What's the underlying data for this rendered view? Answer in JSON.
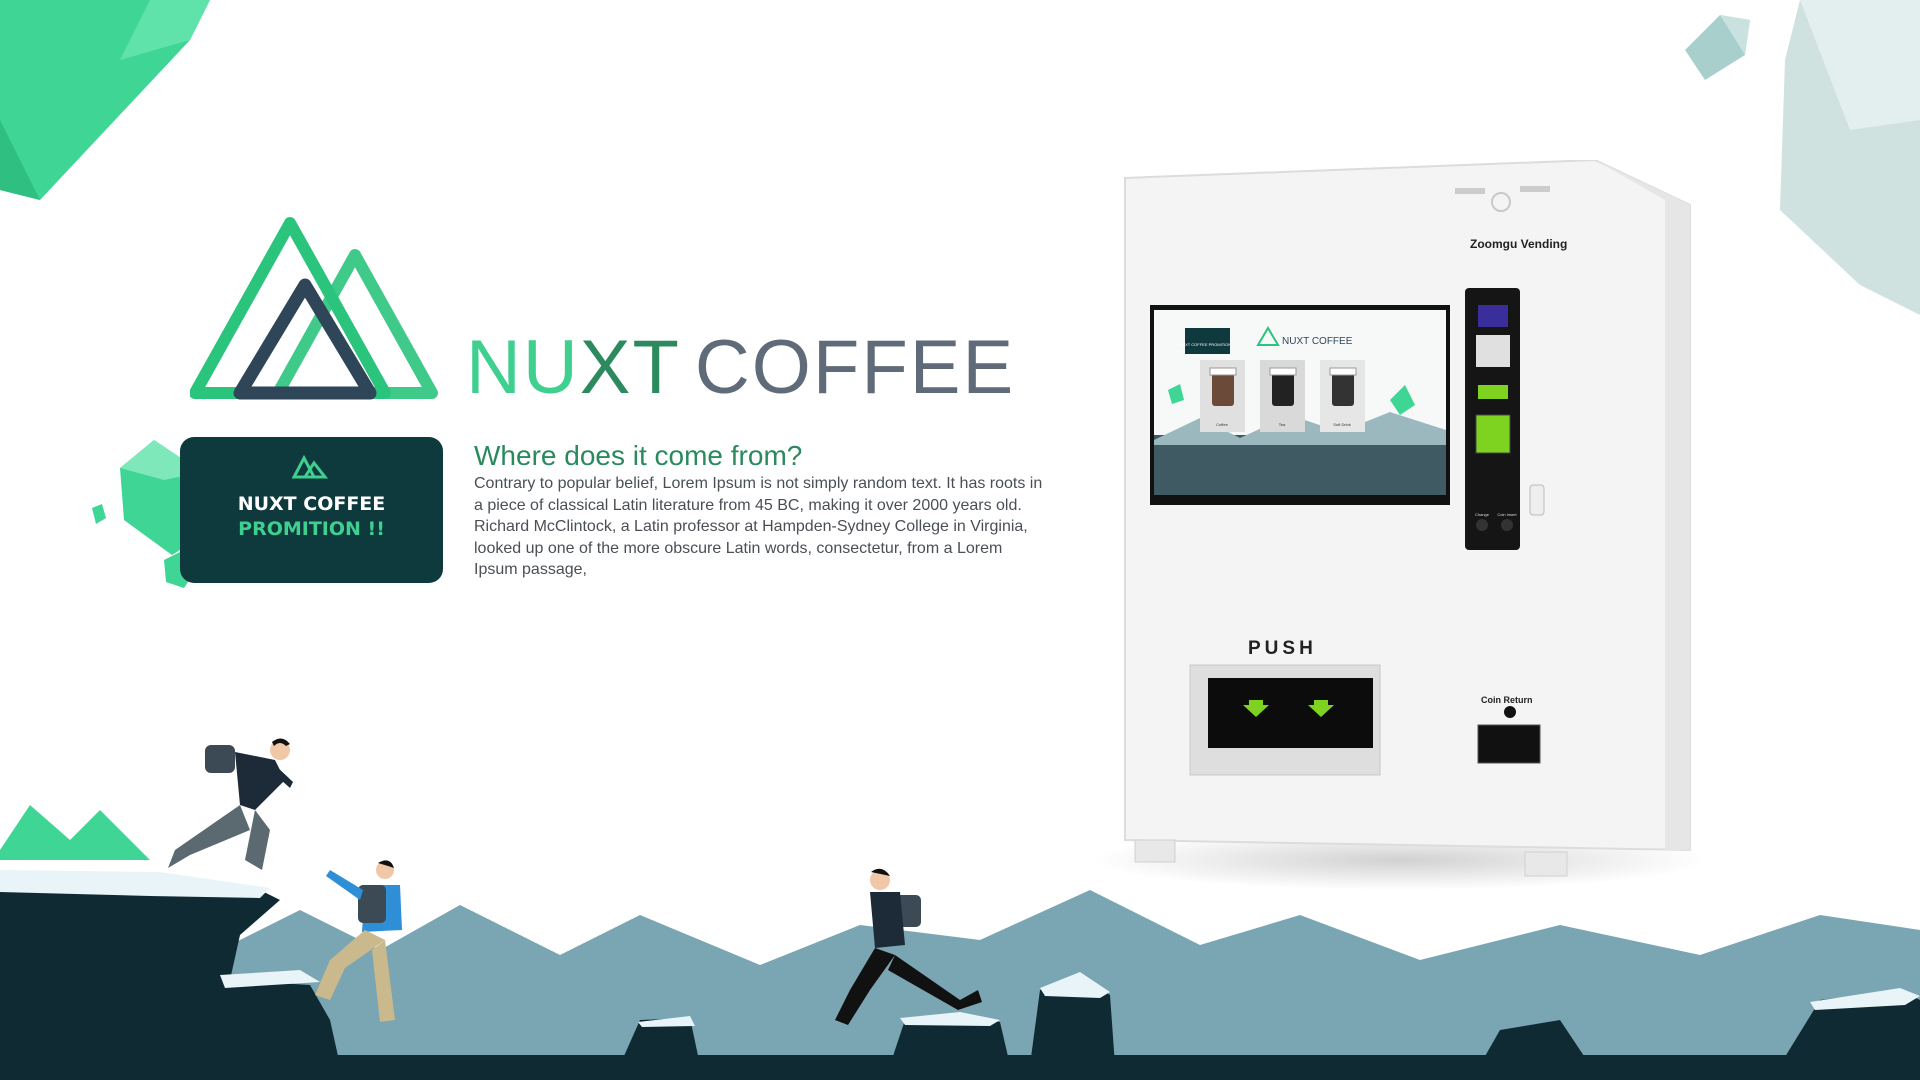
{
  "brand": {
    "title_part1": "NU",
    "title_part2": "XT",
    "title_part3": "COFFEE"
  },
  "promo": {
    "line1": "NUXT COFFEE",
    "line2": "PROMITION !!"
  },
  "description": {
    "heading": "Where does it come from?",
    "body": "Contrary to popular belief, Lorem Ipsum is not simply random text. It has roots in a piece of classical Latin literature from 45 BC, making it over 2000 years old. Richard McClintock, a Latin professor at Hampden-Sydney College in Virginia, looked up one of the more obscure Latin words, consectetur, from a Lorem Ipsum passage,"
  },
  "machine": {
    "brand_label": "Zoomgu Vending",
    "screen_title": "NUXT COFFEE",
    "screen_promo": "NUXT COFFEE PROMITION !!",
    "screen_products": [
      "Coffee",
      "Tea",
      "Soft Drink"
    ],
    "push_label": "PUSH",
    "coin_return_label": "Coin Return",
    "change_label": "Change",
    "coin_insert_label": "Coin Insert"
  },
  "colors": {
    "brand_green": "#3fcf8f",
    "brand_dark": "#0e3a3d",
    "mountain_blue": "#7aa5b3",
    "cliff_dark": "#0f2a33"
  }
}
